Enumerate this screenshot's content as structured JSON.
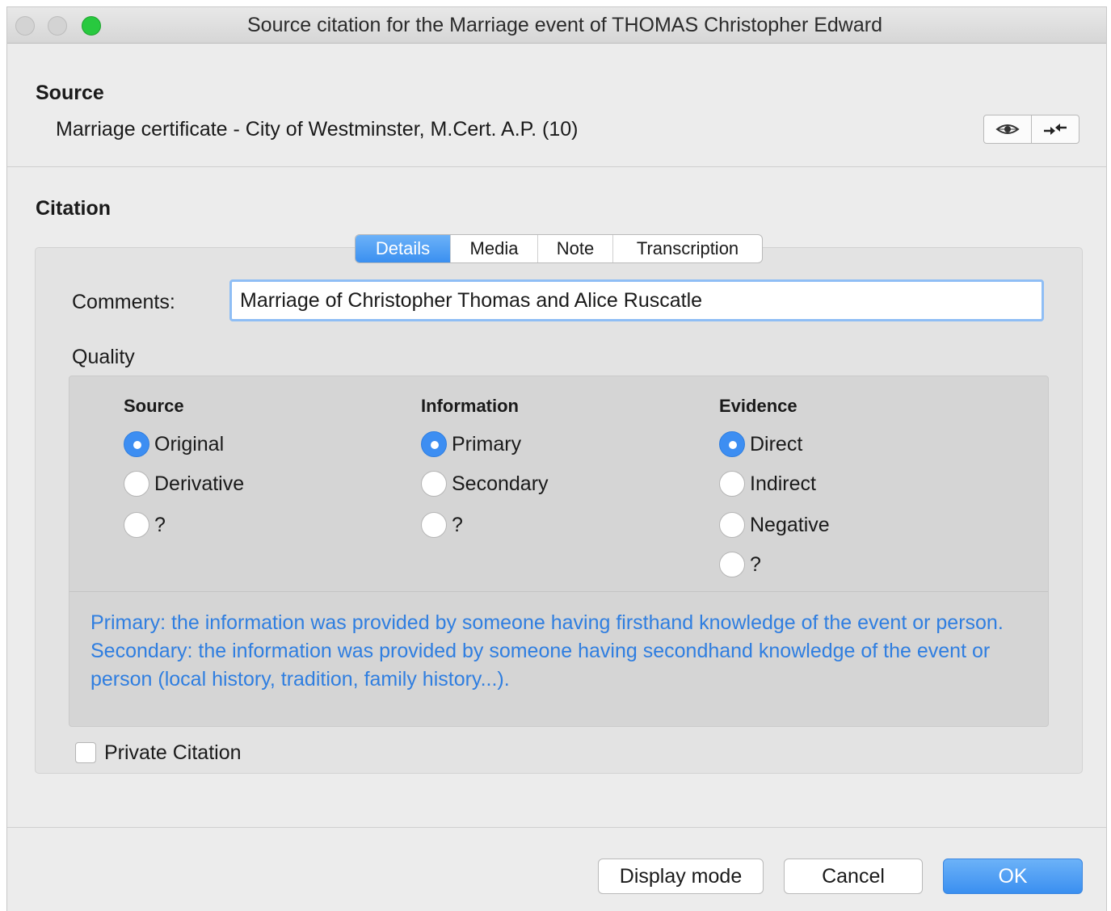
{
  "window": {
    "title": "Source citation for the Marriage event of THOMAS Christopher Edward"
  },
  "source": {
    "heading": "Source",
    "value": "Marriage certificate - City of Westminster, M.Cert. A.P. (10)",
    "buttons": [
      {
        "icon": "eye-icon"
      },
      {
        "icon": "swap-arrows-icon"
      }
    ]
  },
  "citation": {
    "heading": "Citation",
    "tabs": [
      {
        "label": "Details",
        "active": true
      },
      {
        "label": "Media",
        "active": false
      },
      {
        "label": "Note",
        "active": false
      },
      {
        "label": "Transcription",
        "active": false
      }
    ],
    "comments_label": "Comments:",
    "comments_value": "Marriage of Christopher Thomas and Alice Ruscatle",
    "quality": {
      "heading": "Quality",
      "columns": [
        {
          "heading": "Source",
          "options": [
            {
              "label": "Original",
              "checked": true
            },
            {
              "label": "Derivative",
              "checked": false
            },
            {
              "label": "?",
              "checked": false
            }
          ]
        },
        {
          "heading": "Information",
          "options": [
            {
              "label": "Primary",
              "checked": true
            },
            {
              "label": "Secondary",
              "checked": false
            },
            {
              "label": "?",
              "checked": false
            }
          ]
        },
        {
          "heading": "Evidence",
          "options": [
            {
              "label": "Direct",
              "checked": true
            },
            {
              "label": "Indirect",
              "checked": false
            },
            {
              "label": "Negative",
              "checked": false
            },
            {
              "label": "?",
              "checked": false
            }
          ]
        }
      ],
      "help_lines": [
        "Primary: the information was provided by someone having firsthand knowledge of the event or person.",
        "Secondary: the information was provided by someone having secondhand knowledge of the event or person (local history, tradition, family history...)."
      ]
    },
    "private_label": "Private Citation",
    "private_checked": false
  },
  "footer": {
    "display_mode_label": "Display mode",
    "cancel_label": "Cancel",
    "ok_label": "OK"
  },
  "colors": {
    "accent": "#3d8ef2",
    "help_text": "#2f7ee0",
    "zoom_button": "#28c93f"
  }
}
